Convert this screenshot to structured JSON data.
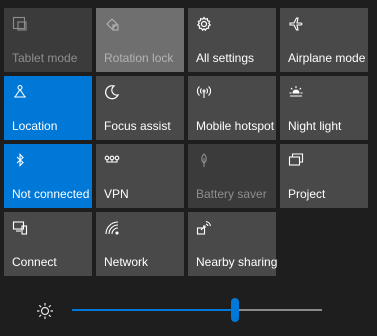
{
  "tiles": [
    {
      "label": "Tablet mode",
      "icon": "tablet-mode-icon",
      "state": "disabled"
    },
    {
      "label": "Rotation lock",
      "icon": "rotation-lock-icon",
      "state": "disabled-light"
    },
    {
      "label": "All settings",
      "icon": "gear-icon",
      "state": "off"
    },
    {
      "label": "Airplane mode",
      "icon": "airplane-icon",
      "state": "off"
    },
    {
      "label": "Location",
      "icon": "location-icon",
      "state": "on"
    },
    {
      "label": "Focus assist",
      "icon": "moon-icon",
      "state": "off"
    },
    {
      "label": "Mobile hotspot",
      "icon": "hotspot-icon",
      "state": "off"
    },
    {
      "label": "Night light",
      "icon": "sun-icon",
      "state": "off"
    },
    {
      "label": "Not connected",
      "icon": "bluetooth-icon",
      "state": "on"
    },
    {
      "label": "VPN",
      "icon": "vpn-icon",
      "state": "off"
    },
    {
      "label": "Battery saver",
      "icon": "battery-saver-icon",
      "state": "disabled"
    },
    {
      "label": "Project",
      "icon": "project-icon",
      "state": "off"
    },
    {
      "label": "Connect",
      "icon": "connect-icon",
      "state": "off"
    },
    {
      "label": "Network",
      "icon": "network-icon",
      "state": "off"
    },
    {
      "label": "Nearby sharing",
      "icon": "nearby-sharing-icon",
      "state": "off"
    }
  ],
  "brightness": {
    "icon": "brightness-icon",
    "level": 0.65
  },
  "colors": {
    "accent": "#0078d7",
    "tile_off": "#494949",
    "tile_disabled": "#3b3b3b",
    "background": "#1e1e1e"
  }
}
